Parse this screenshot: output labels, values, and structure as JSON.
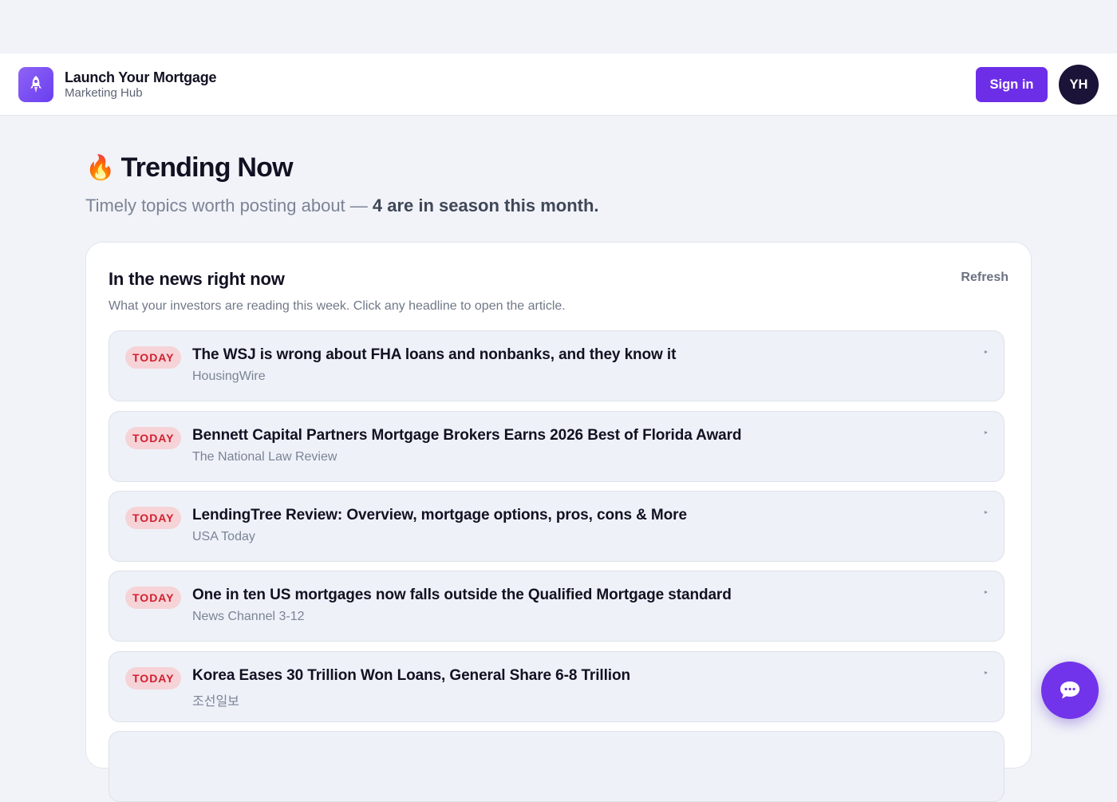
{
  "brand": {
    "name": "Launch Your Mortgage",
    "subtitle": "Marketing Hub",
    "logo_icon": "rocket-icon",
    "accent": "#6d2ee8"
  },
  "header": {
    "signin_label": "Sign in",
    "avatar_initials": "YH"
  },
  "hero": {
    "emoji": "🔥",
    "title": "Trending Now",
    "subtitle_prefix": "Timely topics worth posting about — ",
    "subtitle_strong": "4 are in season this month."
  },
  "news": {
    "title": "In the news right now",
    "refresh_label": "Refresh",
    "description": "What your investors are reading this week. Click any headline to open the article.",
    "items": [
      {
        "badge": "TODAY",
        "headline": "The WSJ is wrong about FHA loans and nonbanks, and they know it",
        "source": "HousingWire"
      },
      {
        "badge": "TODAY",
        "headline": "Bennett Capital Partners Mortgage Brokers Earns 2026 Best of Florida Award",
        "source": "The National Law Review"
      },
      {
        "badge": "TODAY",
        "headline": "LendingTree Review: Overview, mortgage options, pros, cons & More",
        "source": "USA Today"
      },
      {
        "badge": "TODAY",
        "headline": "One in ten US mortgages now falls outside the Qualified Mortgage standard",
        "source": "News Channel 3-12"
      },
      {
        "badge": "TODAY",
        "headline": "Korea Eases 30 Trillion Won Loans, General Share 6-8 Trillion",
        "source": "조선일보"
      }
    ]
  },
  "chat": {
    "icon": "chat-bubble-icon"
  }
}
